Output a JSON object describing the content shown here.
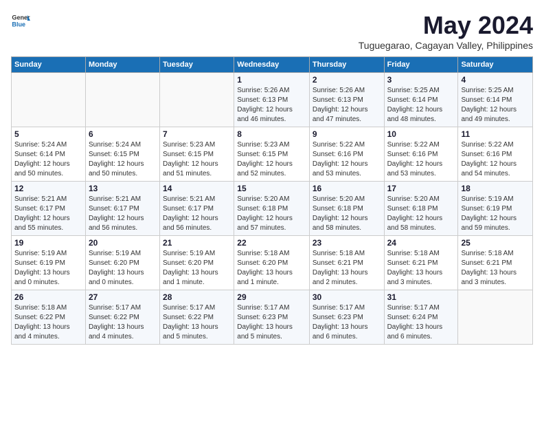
{
  "header": {
    "logo_general": "General",
    "logo_blue": "Blue",
    "month_year": "May 2024",
    "location": "Tuguegarao, Cagayan Valley, Philippines"
  },
  "weekdays": [
    "Sunday",
    "Monday",
    "Tuesday",
    "Wednesday",
    "Thursday",
    "Friday",
    "Saturday"
  ],
  "weeks": [
    [
      {
        "day": "",
        "info": ""
      },
      {
        "day": "",
        "info": ""
      },
      {
        "day": "",
        "info": ""
      },
      {
        "day": "1",
        "info": "Sunrise: 5:26 AM\nSunset: 6:13 PM\nDaylight: 12 hours\nand 46 minutes."
      },
      {
        "day": "2",
        "info": "Sunrise: 5:26 AM\nSunset: 6:13 PM\nDaylight: 12 hours\nand 47 minutes."
      },
      {
        "day": "3",
        "info": "Sunrise: 5:25 AM\nSunset: 6:14 PM\nDaylight: 12 hours\nand 48 minutes."
      },
      {
        "day": "4",
        "info": "Sunrise: 5:25 AM\nSunset: 6:14 PM\nDaylight: 12 hours\nand 49 minutes."
      }
    ],
    [
      {
        "day": "5",
        "info": "Sunrise: 5:24 AM\nSunset: 6:14 PM\nDaylight: 12 hours\nand 50 minutes."
      },
      {
        "day": "6",
        "info": "Sunrise: 5:24 AM\nSunset: 6:15 PM\nDaylight: 12 hours\nand 50 minutes."
      },
      {
        "day": "7",
        "info": "Sunrise: 5:23 AM\nSunset: 6:15 PM\nDaylight: 12 hours\nand 51 minutes."
      },
      {
        "day": "8",
        "info": "Sunrise: 5:23 AM\nSunset: 6:15 PM\nDaylight: 12 hours\nand 52 minutes."
      },
      {
        "day": "9",
        "info": "Sunrise: 5:22 AM\nSunset: 6:16 PM\nDaylight: 12 hours\nand 53 minutes."
      },
      {
        "day": "10",
        "info": "Sunrise: 5:22 AM\nSunset: 6:16 PM\nDaylight: 12 hours\nand 53 minutes."
      },
      {
        "day": "11",
        "info": "Sunrise: 5:22 AM\nSunset: 6:16 PM\nDaylight: 12 hours\nand 54 minutes."
      }
    ],
    [
      {
        "day": "12",
        "info": "Sunrise: 5:21 AM\nSunset: 6:17 PM\nDaylight: 12 hours\nand 55 minutes."
      },
      {
        "day": "13",
        "info": "Sunrise: 5:21 AM\nSunset: 6:17 PM\nDaylight: 12 hours\nand 56 minutes."
      },
      {
        "day": "14",
        "info": "Sunrise: 5:21 AM\nSunset: 6:17 PM\nDaylight: 12 hours\nand 56 minutes."
      },
      {
        "day": "15",
        "info": "Sunrise: 5:20 AM\nSunset: 6:18 PM\nDaylight: 12 hours\nand 57 minutes."
      },
      {
        "day": "16",
        "info": "Sunrise: 5:20 AM\nSunset: 6:18 PM\nDaylight: 12 hours\nand 58 minutes."
      },
      {
        "day": "17",
        "info": "Sunrise: 5:20 AM\nSunset: 6:18 PM\nDaylight: 12 hours\nand 58 minutes."
      },
      {
        "day": "18",
        "info": "Sunrise: 5:19 AM\nSunset: 6:19 PM\nDaylight: 12 hours\nand 59 minutes."
      }
    ],
    [
      {
        "day": "19",
        "info": "Sunrise: 5:19 AM\nSunset: 6:19 PM\nDaylight: 13 hours\nand 0 minutes."
      },
      {
        "day": "20",
        "info": "Sunrise: 5:19 AM\nSunset: 6:20 PM\nDaylight: 13 hours\nand 0 minutes."
      },
      {
        "day": "21",
        "info": "Sunrise: 5:19 AM\nSunset: 6:20 PM\nDaylight: 13 hours\nand 1 minute."
      },
      {
        "day": "22",
        "info": "Sunrise: 5:18 AM\nSunset: 6:20 PM\nDaylight: 13 hours\nand 1 minute."
      },
      {
        "day": "23",
        "info": "Sunrise: 5:18 AM\nSunset: 6:21 PM\nDaylight: 13 hours\nand 2 minutes."
      },
      {
        "day": "24",
        "info": "Sunrise: 5:18 AM\nSunset: 6:21 PM\nDaylight: 13 hours\nand 3 minutes."
      },
      {
        "day": "25",
        "info": "Sunrise: 5:18 AM\nSunset: 6:21 PM\nDaylight: 13 hours\nand 3 minutes."
      }
    ],
    [
      {
        "day": "26",
        "info": "Sunrise: 5:18 AM\nSunset: 6:22 PM\nDaylight: 13 hours\nand 4 minutes."
      },
      {
        "day": "27",
        "info": "Sunrise: 5:17 AM\nSunset: 6:22 PM\nDaylight: 13 hours\nand 4 minutes."
      },
      {
        "day": "28",
        "info": "Sunrise: 5:17 AM\nSunset: 6:22 PM\nDaylight: 13 hours\nand 5 minutes."
      },
      {
        "day": "29",
        "info": "Sunrise: 5:17 AM\nSunset: 6:23 PM\nDaylight: 13 hours\nand 5 minutes."
      },
      {
        "day": "30",
        "info": "Sunrise: 5:17 AM\nSunset: 6:23 PM\nDaylight: 13 hours\nand 6 minutes."
      },
      {
        "day": "31",
        "info": "Sunrise: 5:17 AM\nSunset: 6:24 PM\nDaylight: 13 hours\nand 6 minutes."
      },
      {
        "day": "",
        "info": ""
      }
    ]
  ]
}
